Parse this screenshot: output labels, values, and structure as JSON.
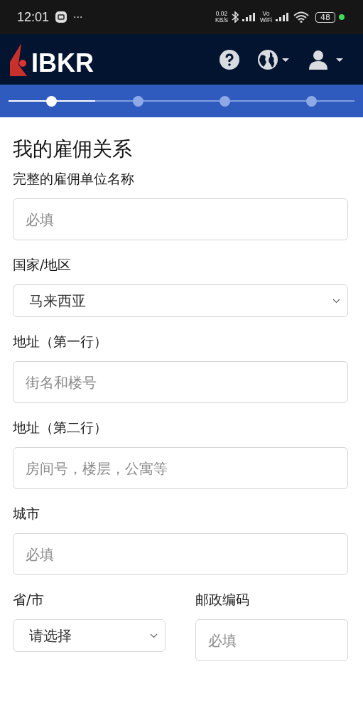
{
  "status_bar": {
    "time": "12:01",
    "more": "···",
    "speed": [
      "0.02",
      "KB/s"
    ],
    "vowifi": [
      "Vo",
      "WiFi"
    ],
    "battery": "48"
  },
  "header": {
    "logo": "IBKR"
  },
  "progress": {
    "level": 0.25,
    "steps": [
      {
        "selected": true
      },
      {
        "selected": false
      },
      {
        "selected": false
      },
      {
        "selected": false
      }
    ]
  },
  "title": "我的雇佣关系",
  "rows": [
    [
      {
        "kind": "text",
        "label": "完整的雇佣单位名称",
        "placeholder": "必填"
      }
    ],
    [
      {
        "kind": "select",
        "label": "国家/地区",
        "value": "马来西亚"
      }
    ],
    [
      {
        "kind": "text",
        "label": "地址（第一行）",
        "placeholder": "街名和楼号"
      }
    ],
    [
      {
        "kind": "text",
        "label": "地址（第二行）",
        "placeholder": "房间号，楼层，公寓等"
      }
    ],
    [
      {
        "kind": "text",
        "label": "城市",
        "placeholder": "必填"
      }
    ],
    [
      {
        "kind": "select",
        "label": "省/市",
        "value": "请选择"
      },
      {
        "kind": "text",
        "label": "邮政编码",
        "placeholder": "必填"
      }
    ]
  ]
}
